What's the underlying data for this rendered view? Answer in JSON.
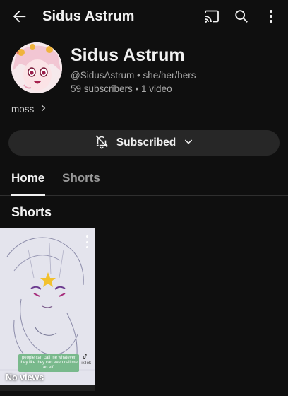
{
  "appbar": {
    "title": "Sidus Astrum",
    "icons": [
      "back-arrow-icon",
      "cast-icon",
      "search-icon",
      "more-vert-icon"
    ]
  },
  "channel": {
    "name": "Sidus Astrum",
    "handle": "@SidusAstrum",
    "pronouns": "she/her/hers",
    "subscribers": "59 subscribers",
    "videos": "1 video",
    "link_text": "moss"
  },
  "subscribe_button": {
    "label": "Subscribed",
    "icons": [
      "bell-off-icon",
      "chevron-down-icon"
    ]
  },
  "tabs": [
    {
      "label": "Home",
      "active": true
    },
    {
      "label": "Shorts",
      "active": false
    }
  ],
  "sections": {
    "shorts_title": "Shorts"
  },
  "shorts": [
    {
      "views": "No views",
      "caption": "people can call me whatever they like they can even call me an elf!",
      "watermark": "TikTok"
    }
  ],
  "colors": {
    "background": "#0f0f0f",
    "button_bg": "#272727",
    "text_primary": "#f1f1f1",
    "text_secondary": "#aaaaaa",
    "caption_green": "#79b98c"
  }
}
